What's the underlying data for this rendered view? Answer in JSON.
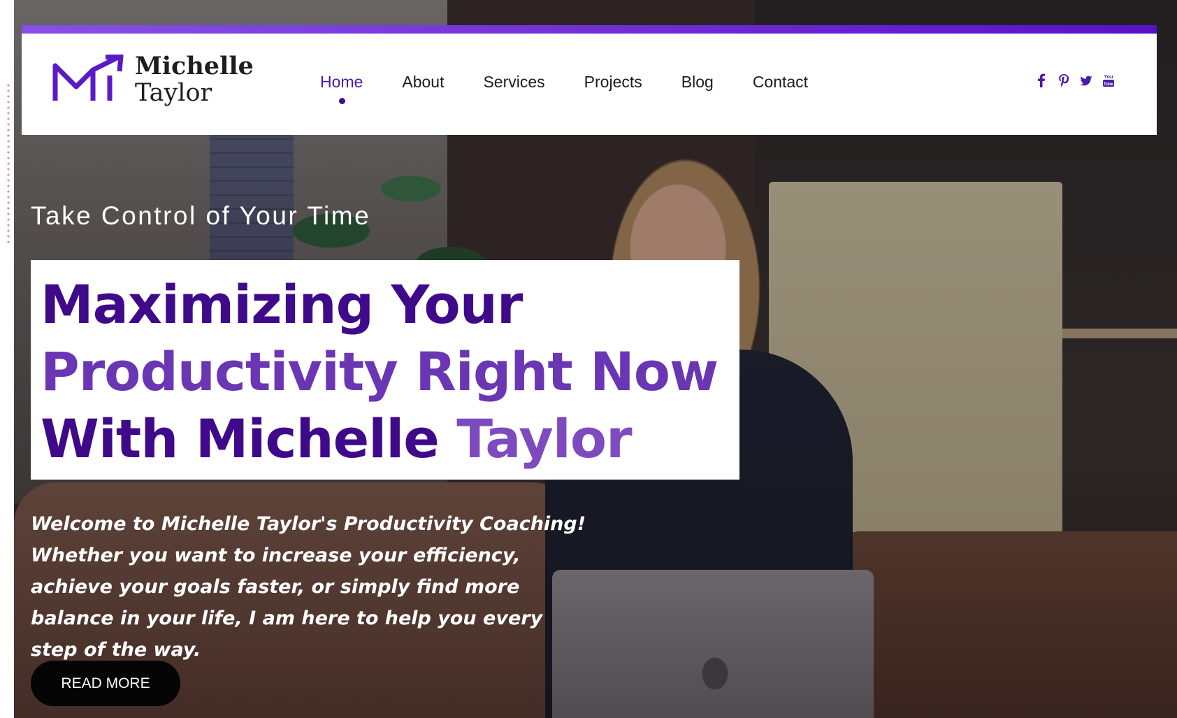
{
  "brand": {
    "name_line1": "Michelle",
    "name_line2": "Taylor",
    "accent_color": "#4a1aa8",
    "logo_icon": "m-arrow-logo-icon"
  },
  "nav": {
    "items": [
      {
        "label": "Home",
        "active": true
      },
      {
        "label": "About",
        "active": false
      },
      {
        "label": "Services",
        "active": false
      },
      {
        "label": "Projects",
        "active": false
      },
      {
        "label": "Blog",
        "active": false
      },
      {
        "label": "Contact",
        "active": false
      }
    ]
  },
  "social": {
    "icons": [
      "facebook-icon",
      "pinterest-icon",
      "twitter-icon",
      "youtube-icon"
    ]
  },
  "hero": {
    "tagline": "Take Control of Your Time",
    "headline": {
      "line1": "Maximizing Your",
      "line2": "Productivity Right Now",
      "line3_part1": "With Michelle ",
      "line3_part2": "Taylor"
    },
    "intro": "Welcome to Michelle Taylor's Productivity Coaching! Whether you want to increase your efficiency, achieve your goals faster, or simply find more balance in your life, I am here to help you every step of the way.",
    "cta_label": "READ MORE"
  },
  "colors": {
    "headline_deep": "#3f0a8a",
    "headline_light": "#7d4bbf",
    "header_bar": "#6a22d4",
    "button_bg": "#050505"
  }
}
